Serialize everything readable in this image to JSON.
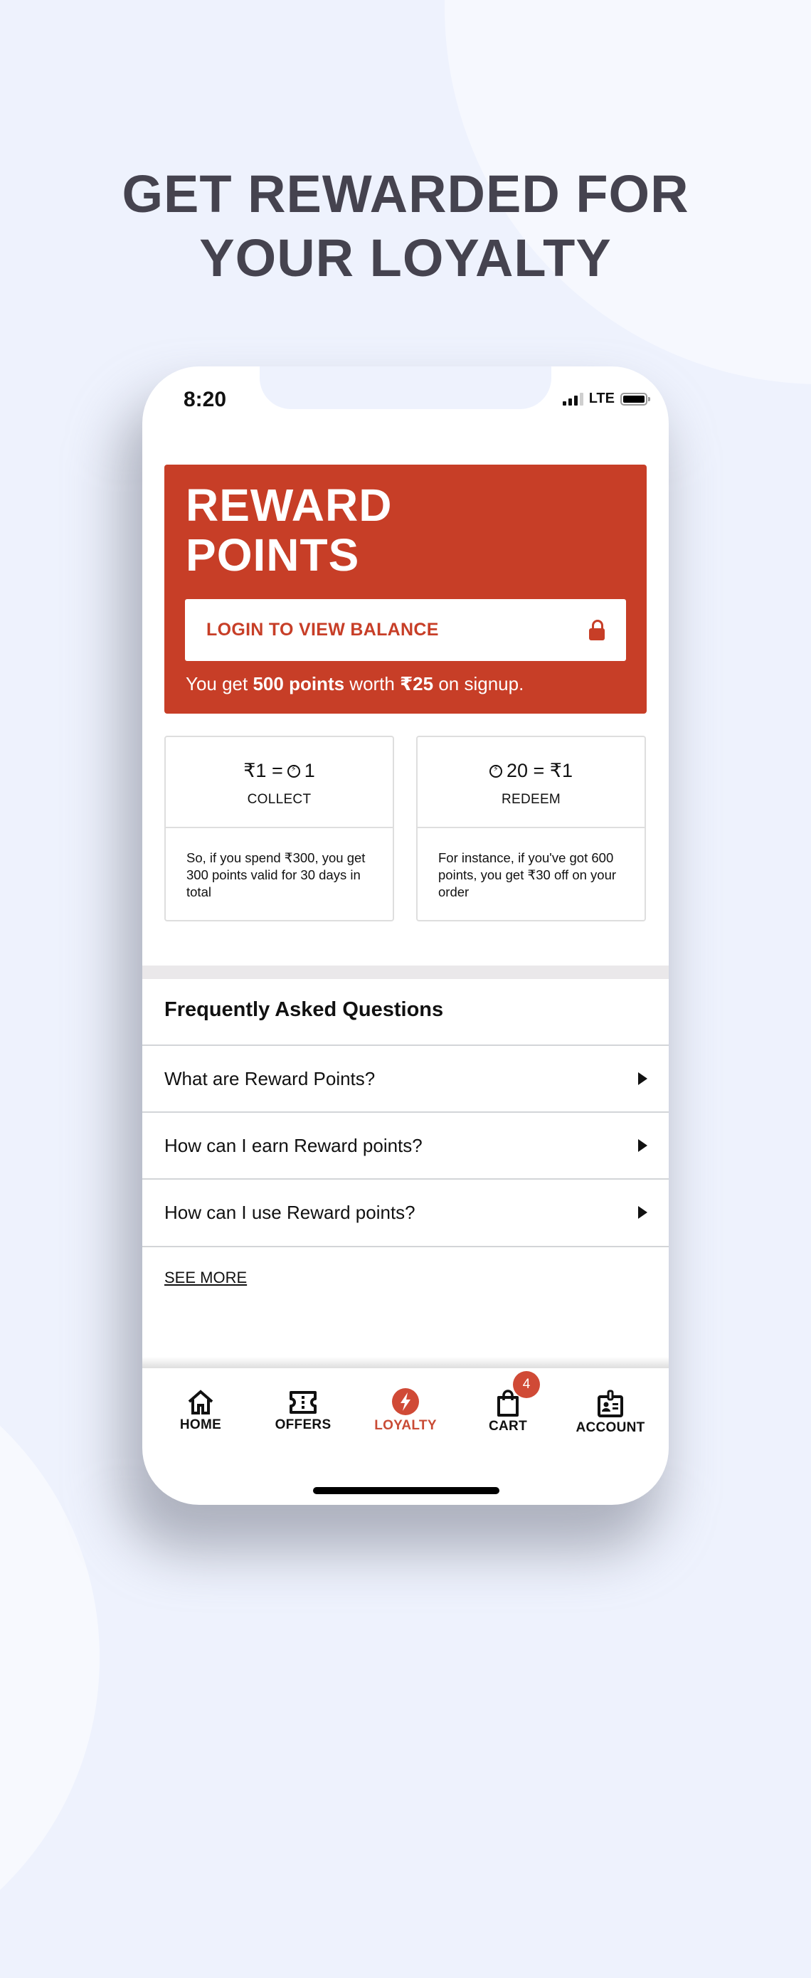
{
  "headline": {
    "line1": "GET REWARDED FOR",
    "line2": "YOUR LOYALTY"
  },
  "status_bar": {
    "time": "8:20",
    "network": "LTE",
    "signal_bars_active": 3,
    "signal_bars_total": 4
  },
  "reward_card": {
    "title_line1": "REWARD",
    "title_line2": "POINTS",
    "login_button_label": "LOGIN TO VIEW BALANCE",
    "login_icon": "lock-icon",
    "signup_note": {
      "prefix": "You get ",
      "points": "500 points",
      "middle": " worth ",
      "amount": "₹25",
      "suffix": " on signup."
    },
    "color": "#C73E27"
  },
  "info_cards": [
    {
      "rate_left": "₹1 =",
      "rate_right": "1",
      "rate_icon": "points-coin-icon",
      "label": "COLLECT",
      "description": "So, if you spend ₹300, you get 300 points valid for 30 days in total"
    },
    {
      "rate_left": "20 = ₹1",
      "rate_icon": "points-coin-icon",
      "label": "REDEEM",
      "description": "For instance, if you've got 600 points, you get ₹30 off on your order"
    }
  ],
  "faq": {
    "title": "Frequently Asked Questions",
    "items": [
      {
        "question": "What are Reward Points?"
      },
      {
        "question": "How can I earn Reward points?"
      },
      {
        "question": "How can I use Reward points?"
      }
    ],
    "see_more_label": "SEE MORE"
  },
  "bottom_nav": {
    "items": [
      {
        "label": "HOME",
        "icon": "home-icon",
        "active": false
      },
      {
        "label": "OFFERS",
        "icon": "ticket-icon",
        "active": false
      },
      {
        "label": "LOYALTY",
        "icon": "lightning-icon",
        "active": true
      },
      {
        "label": "CART",
        "icon": "shopping-bag-icon",
        "active": false,
        "badge": "4"
      },
      {
        "label": "ACCOUNT",
        "icon": "id-badge-icon",
        "active": false
      }
    ],
    "active_color": "#C94B35"
  }
}
